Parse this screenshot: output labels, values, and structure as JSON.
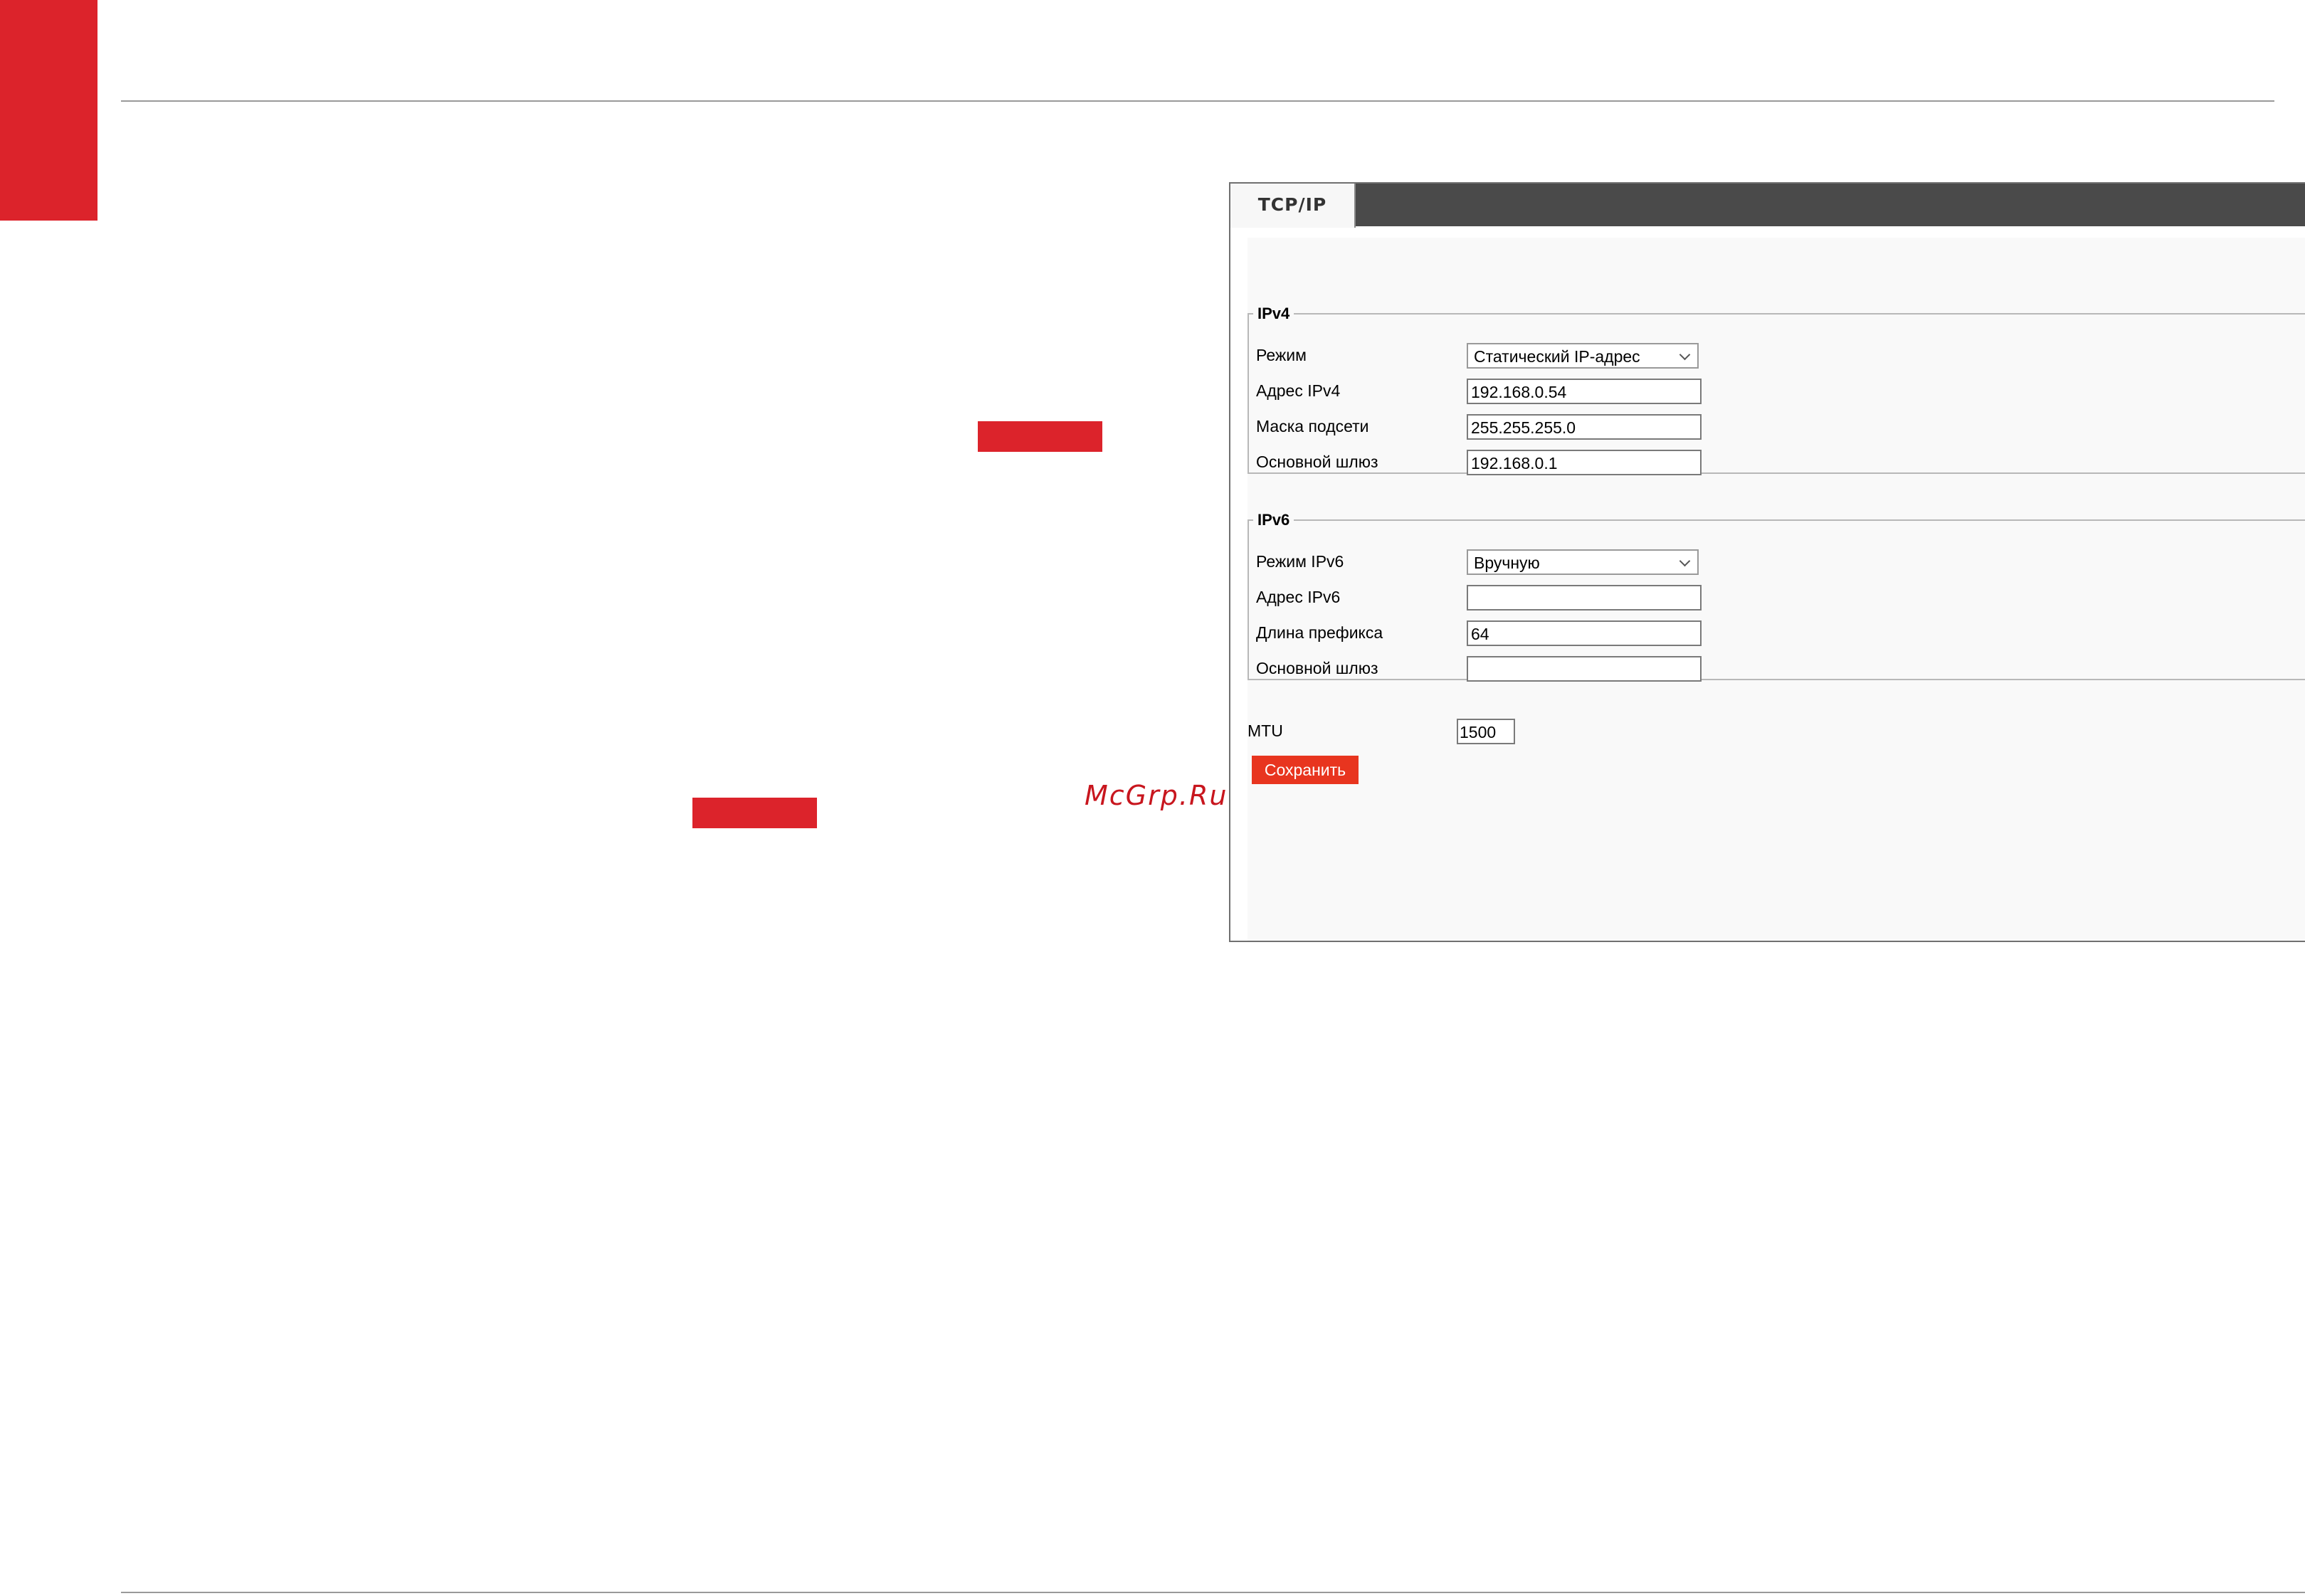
{
  "watermark": "McGrp.Ru",
  "tabs": [
    {
      "label": "TCP/IP",
      "active": true
    }
  ],
  "ipv4": {
    "legend": "IPv4",
    "mode": {
      "label": "Режим",
      "value": "Статический IP-адрес"
    },
    "address": {
      "label": "Адрес IPv4",
      "value": "192.168.0.54"
    },
    "mask": {
      "label": "Маска подсети",
      "value": "255.255.255.0"
    },
    "gateway": {
      "label": "Основной шлюз",
      "value": "192.168.0.1"
    }
  },
  "ipv6": {
    "legend": "IPv6",
    "mode": {
      "label": "Режим IPv6",
      "value": "Вручную"
    },
    "address": {
      "label": "Адрес IPv6",
      "value": ""
    },
    "prefix": {
      "label": "Длина префикса",
      "value": "64"
    },
    "gateway": {
      "label": "Основной шлюз",
      "value": ""
    }
  },
  "mtu": {
    "label": "MTU",
    "value": "1500"
  },
  "save_label": "Сохранить",
  "colors": {
    "brand_red": "#dc232b",
    "button_red": "#e8351f",
    "tabbar": "#4a4a4a"
  },
  "icons": {
    "dropdown": "chevron-down-icon"
  }
}
